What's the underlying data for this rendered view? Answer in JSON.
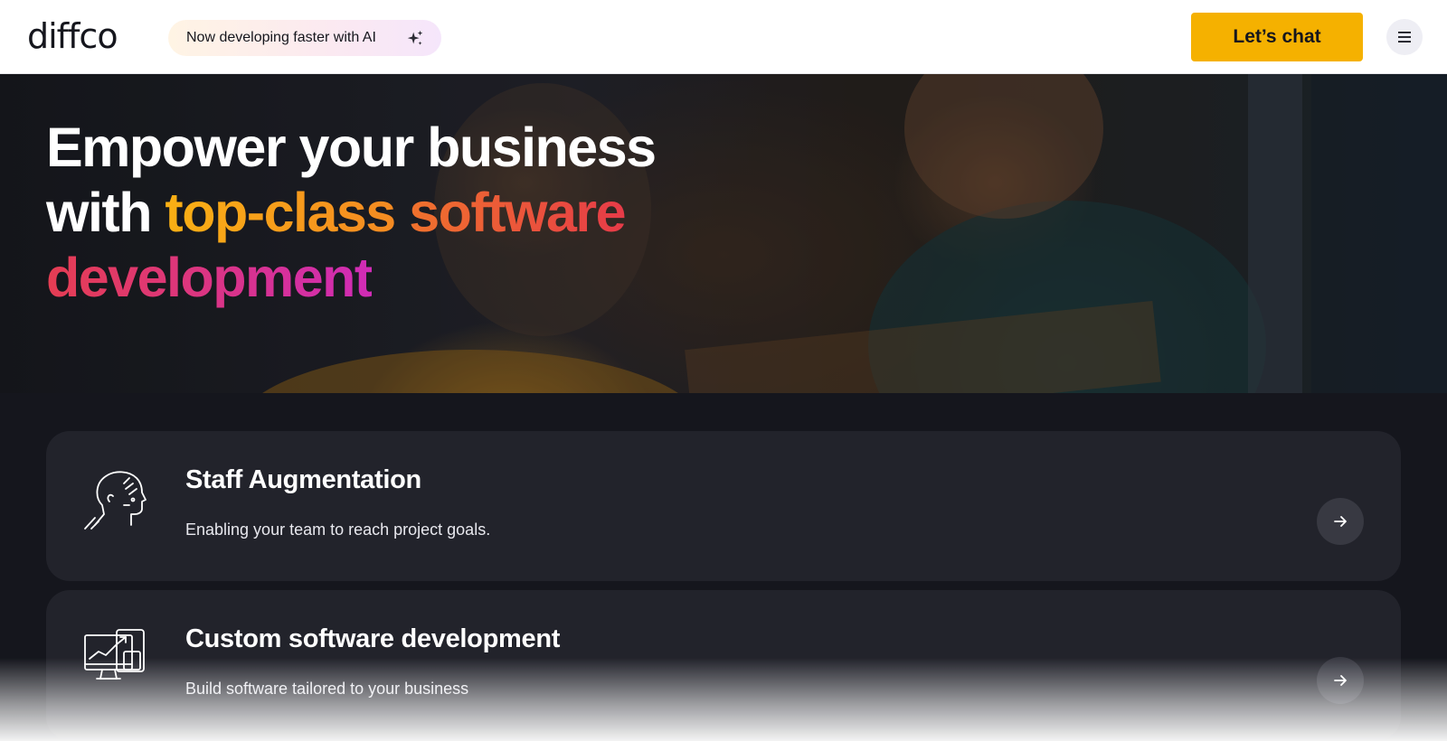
{
  "header": {
    "logo": "diffco",
    "ai_pill": "Now developing faster with AI",
    "chat_button": "Let’s chat"
  },
  "hero": {
    "line1": "Empower your business",
    "line2_prefix": "with ",
    "line2_a": "top-class",
    "line2_b": "software",
    "line3": "development"
  },
  "services": [
    {
      "title": "Staff Augmentation",
      "description": "Enabling your team to reach project goals.",
      "icon": "head-mind-icon"
    },
    {
      "title": "Custom software development",
      "description": "Build software tailored to your business",
      "icon": "devices-growth-icon"
    }
  ],
  "colors": {
    "accent": "#f5b100",
    "dark_bg": "#15161d",
    "card_bg": "#22232b"
  }
}
